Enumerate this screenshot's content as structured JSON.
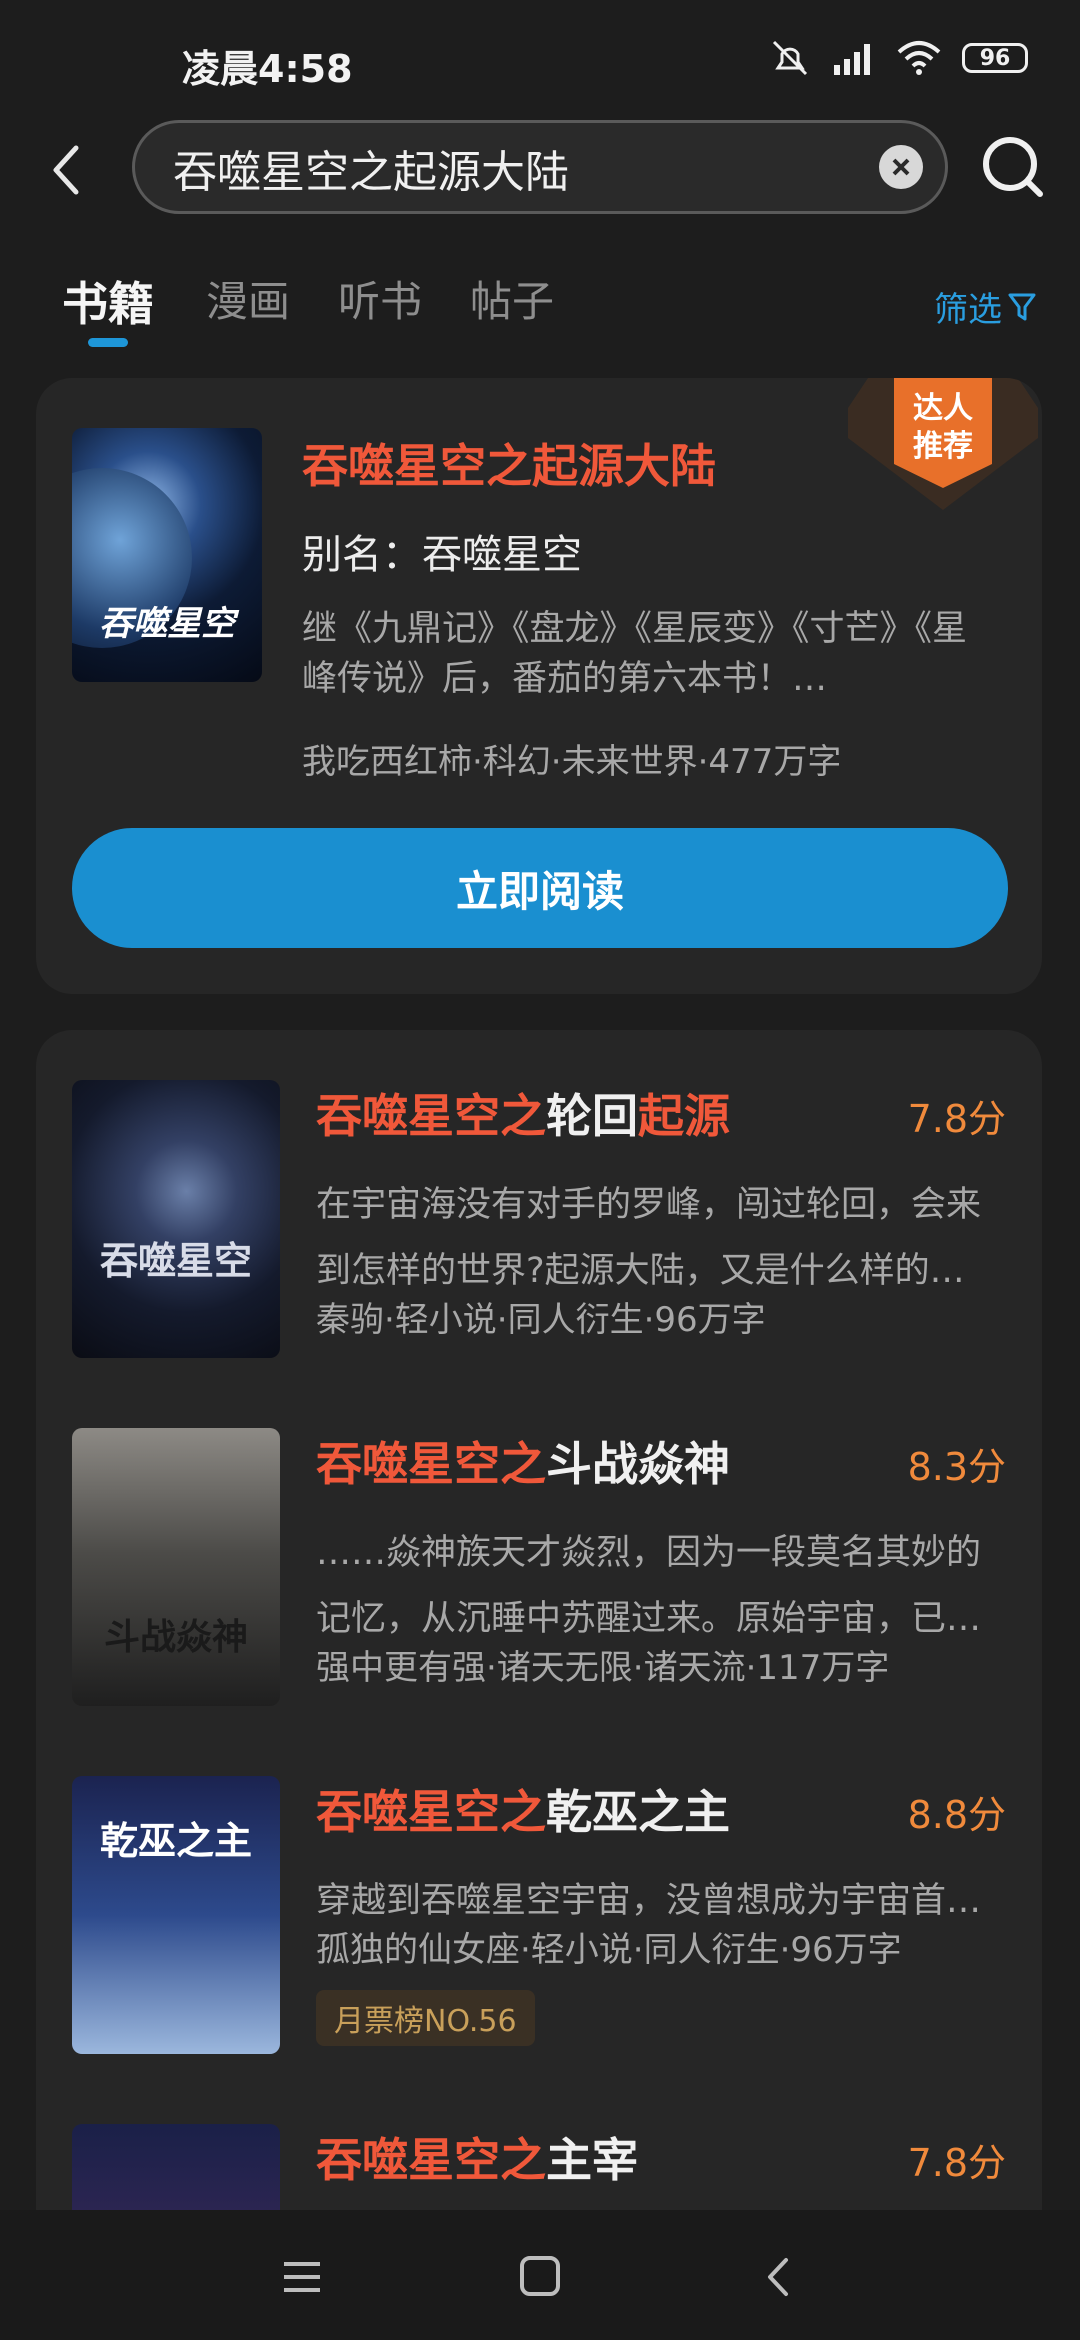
{
  "status_bar": {
    "time": "凌晨4:58",
    "battery": "96"
  },
  "search": {
    "query": "吞噬星空之起源大陆"
  },
  "tabs": [
    {
      "label": "书籍"
    },
    {
      "label": "漫画"
    },
    {
      "label": "听书"
    },
    {
      "label": "帖子"
    }
  ],
  "filter_label": "筛选",
  "featured": {
    "badge_line1": "达人",
    "badge_line2": "推荐",
    "title": "吞噬星空之起源大陆",
    "alias": "别名：吞噬星空",
    "description": "继《九鼎记》《盘龙》《星辰变》《寸芒》《星峰传说》后，番茄的第六本书！…",
    "meta": "我吃西红柿·科幻·未来世界·477万字",
    "cover_text": "吞噬星空",
    "read_button": "立即阅读"
  },
  "results": [
    {
      "title_highlight": "吞噬星空之",
      "title_rest": "轮回",
      "title_highlight2": "起源",
      "score": "7.8分",
      "description": "在宇宙海没有对手的罗峰，闯过轮回，会来到怎样的世界?起源大陆，又是什么样的…",
      "meta": "秦驹·轻小说·同人衍生·96万字",
      "cover_text": "吞噬星空"
    },
    {
      "title_highlight": "吞噬星空之",
      "title_rest": "斗战焱神",
      "score": "8.3分",
      "description": "……焱神族天才焱烈，因为一段莫名其妙的记忆，从沉睡中苏醒过来。原始宇宙，已…",
      "meta": "强中更有强·诸天无限·诸天流·117万字",
      "cover_text": "斗战焱神"
    },
    {
      "title_highlight": "吞噬星空之",
      "title_rest": "乾巫之主",
      "score": "8.8分",
      "description": "穿越到吞噬星空宇宙，没曾想成为宇宙首…",
      "meta": "孤独的仙女座·轻小说·同人衍生·96万字",
      "rank_tag": "月票榜NO.56",
      "cover_text": "乾巫之主"
    },
    {
      "title_highlight": "吞噬星空之",
      "title_rest": "主宰",
      "score": "7.8分"
    }
  ],
  "colors": {
    "accent_blue": "#1a8fd0",
    "highlight_red": "#f0583a",
    "score_orange": "#f08a3c",
    "background": "#1d1d1d"
  },
  "icons": [
    "back-icon",
    "clear-icon",
    "search-icon",
    "filter-icon",
    "menu-icon",
    "home-icon",
    "nav-back-icon"
  ]
}
